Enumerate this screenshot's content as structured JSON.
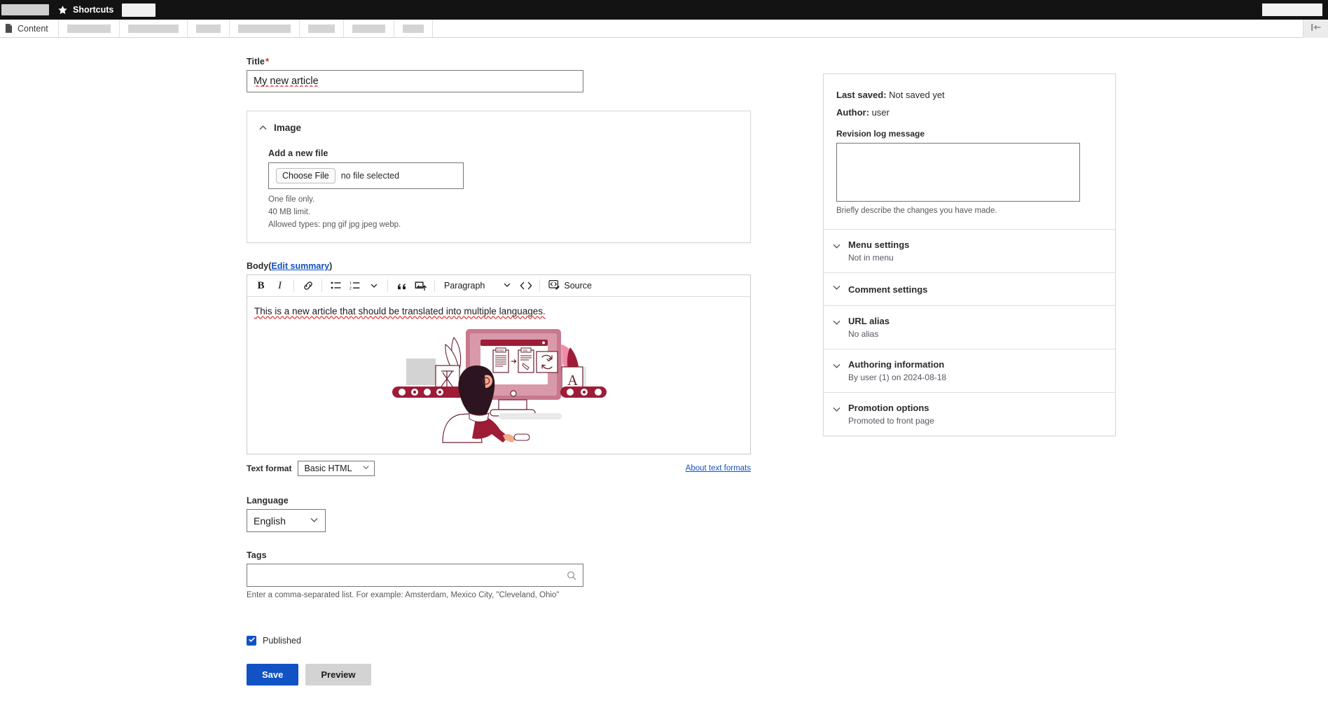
{
  "toolbar": {
    "shortcuts_label": "Shortcuts",
    "star_icon": "star-icon",
    "content_tab": "Content",
    "doc_icon": "document-icon",
    "collapse_icon": "collapse-sidebar-icon",
    "skeleton_widths_top": [
      68
    ],
    "skeleton_widths_second": [
      62,
      72,
      35,
      75,
      38,
      47,
      30
    ]
  },
  "form": {
    "title": {
      "label": "Title",
      "required_mark": "*",
      "value": "My new article",
      "placeholder": ""
    },
    "image": {
      "legend": "Image",
      "chevron_icon": "chevron-up-icon",
      "add_file_label": "Add a new file",
      "choose_file_button": "Choose File",
      "no_file_text": "no file selected",
      "help": [
        "One file only.",
        "40 MB limit.",
        "Allowed types: png gif jpg jpeg webp."
      ]
    },
    "body": {
      "label": "Body",
      "edit_summary_link": "Edit summary",
      "open_paren": "(",
      "close_paren": ")",
      "text": "This is a new article that should be translated into multiple languages.",
      "illustration_alt": "translation-illustration",
      "toolbar_items": [
        {
          "name": "bold-icon",
          "label": "B"
        },
        {
          "name": "italic-icon",
          "label": "I"
        },
        {
          "name": "link-icon",
          "label": ""
        },
        {
          "name": "bulleted-list-icon",
          "label": ""
        },
        {
          "name": "numbered-list-icon",
          "label": ""
        },
        {
          "name": "chevron-down-icon",
          "label": ""
        },
        {
          "name": "block-quote-icon",
          "label": ""
        },
        {
          "name": "insert-image-icon",
          "label": ""
        },
        {
          "name": "code-icon",
          "label": ""
        }
      ],
      "paragraph_dropdown": "Paragraph",
      "source_label": "Source",
      "source_icon": "source-editing-icon"
    },
    "text_format": {
      "label": "Text format",
      "value": "Basic HTML",
      "about_link": "About text formats"
    },
    "language": {
      "label": "Language",
      "value": "English"
    },
    "tags": {
      "label": "Tags",
      "value": "",
      "placeholder": "",
      "search_icon": "search-icon",
      "help": "Enter a comma-separated list. For example: Amsterdam, Mexico City, \"Cleveland, Ohio\""
    },
    "published": {
      "label": "Published",
      "checked": true,
      "check_icon": "checkmark-icon"
    },
    "actions": {
      "save": "Save",
      "preview": "Preview"
    }
  },
  "sidebar": {
    "last_saved_label": "Last saved:",
    "last_saved_value": "Not saved yet",
    "author_label": "Author:",
    "author_value": "user",
    "revision_log_label": "Revision log message",
    "revision_log_value": "",
    "revision_log_help": "Briefly describe the changes you have made.",
    "sections": [
      {
        "title": "Menu settings",
        "summary": "Not in menu",
        "icon": "chevron-down-icon"
      },
      {
        "title": "Comment settings",
        "summary": "",
        "icon": "chevron-down-icon"
      },
      {
        "title": "URL alias",
        "summary": "No alias",
        "icon": "chevron-down-icon"
      },
      {
        "title": "Authoring information",
        "summary": "By user (1) on 2024-08-18",
        "icon": "chevron-down-icon"
      },
      {
        "title": "Promotion options",
        "summary": "Promoted to front page",
        "icon": "chevron-down-icon"
      }
    ]
  },
  "colors": {
    "accent": "#1152c4",
    "toolbar_bg": "#131313",
    "required": "#d72222",
    "link": "#1152c4"
  }
}
